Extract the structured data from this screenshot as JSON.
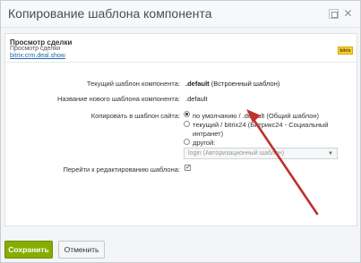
{
  "dialog": {
    "title": "Копирование шаблона компонента"
  },
  "info": {
    "heading": "Просмотр сделки",
    "subheading": "Просмотр сделки",
    "component_code": "bitrix:crm.deal.show",
    "badge": "bitrix"
  },
  "form": {
    "current_template_label": "Текущий шаблон компонента:",
    "current_template_value": ".default",
    "current_template_note": "(Встроенный шаблон)",
    "new_name_label": "Название нового шаблона компонента:",
    "new_name_value": ".default",
    "copy_to_label": "Копировать в шаблон сайта:",
    "options": [
      {
        "label": "по умолчанию / .default (Общий шаблон)",
        "selected": true
      },
      {
        "label": "текущий / bitrix24 (Битрикс24 - Социальный интранет)",
        "selected": false
      },
      {
        "label": "другой:",
        "selected": false
      }
    ],
    "other_select_value": "login (Авторизационный шаблон)",
    "go_to_edit_label": "Перейти к редактированию шаблона:",
    "go_to_edit_checked": true
  },
  "footer": {
    "save_label": "Сохранить",
    "cancel_label": "Отменить"
  },
  "colors": {
    "save_button": "#86ad00",
    "arrow": "#c0302f"
  }
}
